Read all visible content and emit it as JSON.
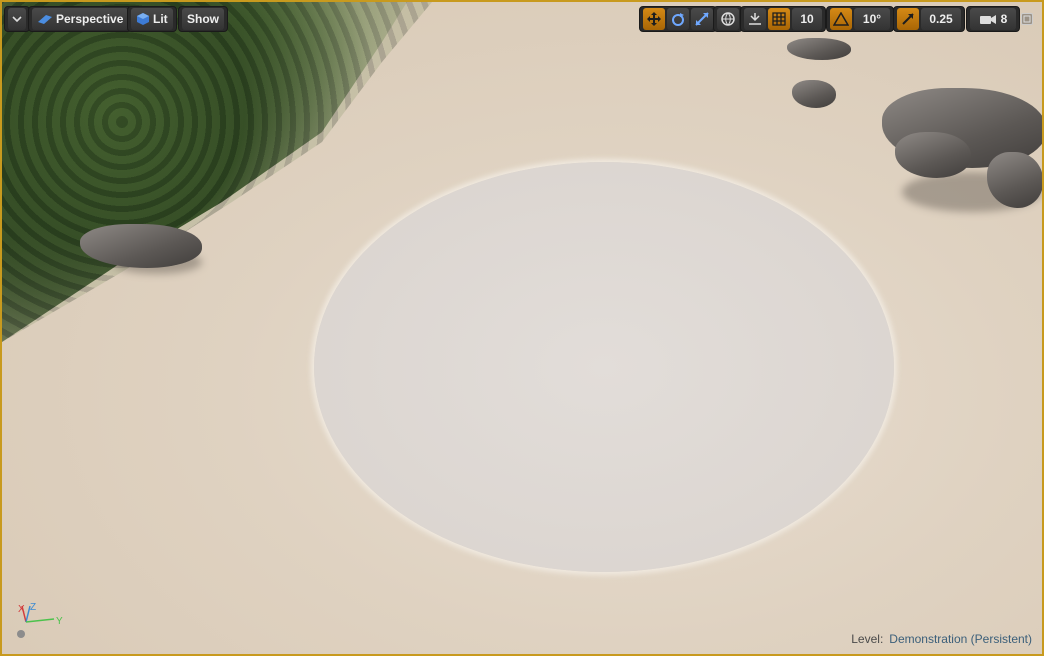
{
  "toolbar": {
    "perspective_label": "Perspective",
    "lit_label": "Lit",
    "show_label": "Show",
    "grid_snap_value": "10",
    "rotation_snap_value": "10°",
    "scale_snap_value": "0.25",
    "camera_speed_value": "8"
  },
  "status": {
    "level_prefix": "Level:",
    "level_name": "Demonstration (Persistent)"
  },
  "axis": {
    "x": "X",
    "y": "Y",
    "z": "Z"
  },
  "colors": {
    "accent": "#d58a16",
    "viewport_border": "#c89a1e",
    "sand": "#dfd2c1"
  }
}
